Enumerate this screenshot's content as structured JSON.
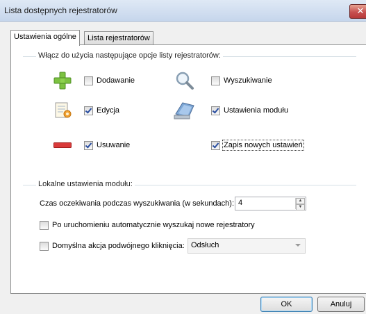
{
  "window": {
    "title": "Lista dostępnych rejestratorów",
    "close_label": "✕"
  },
  "tabs": [
    {
      "label": "Ustawienia ogólne",
      "active": true
    },
    {
      "label": "Lista rejestratorów",
      "active": false
    }
  ],
  "group_options": {
    "label": "Włącz do użycia następujące opcje listy rejestratorów:",
    "options": [
      {
        "label": "Dodawanie",
        "checked": false,
        "icon": "plus-icon"
      },
      {
        "label": "Wyszukiwanie",
        "checked": false,
        "icon": "magnifier-icon"
      },
      {
        "label": "Edycja",
        "checked": true,
        "icon": "edit-document-icon"
      },
      {
        "label": "Ustawienia modułu",
        "checked": true,
        "icon": "module-settings-icon"
      },
      {
        "label": "Usuwanie",
        "checked": true,
        "icon": "minus-icon"
      },
      {
        "label": "Zapis nowych ustawień",
        "checked": true,
        "icon": null
      }
    ]
  },
  "group_local": {
    "label": "Lokalne ustawienia  modułu:",
    "timeout_label": "Czas oczekiwania podczas wyszukiwania (w sekundach):",
    "timeout_value": "4",
    "auto_search_label": "Po uruchomieniu automatycznie wyszukaj nowe rejestratory",
    "auto_search_checked": false,
    "double_click_label": "Domyślna akcja podwójnego kliknięcia:",
    "double_click_checked": false,
    "double_click_value": "Odsłuch"
  },
  "buttons": {
    "ok": "OK",
    "cancel": "Anuluj"
  }
}
